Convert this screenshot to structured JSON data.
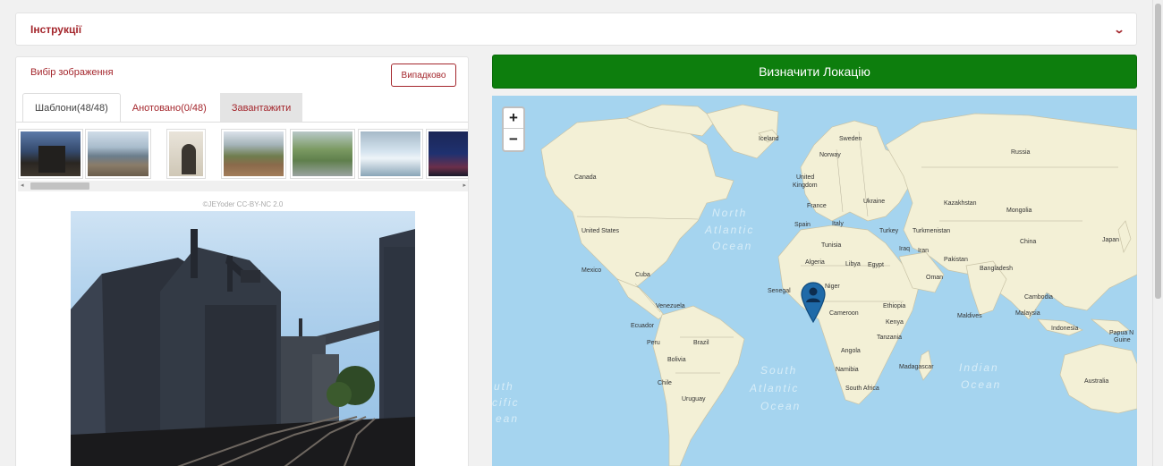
{
  "instructions": {
    "label": "Інструкції",
    "toggle_icon": "chevron-down-icon"
  },
  "image_select": {
    "title": "Вибір зображення",
    "random_button": "Випадково",
    "tabs": [
      {
        "label": "Шаблони(48/48)",
        "active": true
      },
      {
        "label": "Анотовано(0/48)",
        "active": false
      },
      {
        "label": "Завантажити",
        "active": false
      }
    ],
    "thumbnails": [
      "thumbnail",
      "thumbnail",
      "thumbnail",
      "thumbnail",
      "thumbnail",
      "thumbnail",
      "thumbnail"
    ],
    "caption": "©JEYoder CC-BY-NC 2.0"
  },
  "locate_button": "Визначити Локацію",
  "map": {
    "zoom_in": "+",
    "zoom_out": "−",
    "oceans": {
      "north_atlantic_1": "North",
      "north_atlantic_2": "Atlantic",
      "north_atlantic_3": "Ocean",
      "south_atlantic_1": "South",
      "south_atlantic_2": "Atlantic",
      "south_atlantic_3": "Ocean",
      "indian_1": "Indian",
      "indian_2": "Ocean",
      "south_pacific_1": "uth",
      "south_pacific_2": "cific",
      "south_pacific_3": "ean"
    },
    "labels": {
      "iceland": "Iceland",
      "sweden": "Sweden",
      "norway": "Norway",
      "russia": "Russia",
      "canada": "Canada",
      "united_kingdom_1": "United",
      "united_kingdom_2": "Kingdom",
      "france": "France",
      "ukraine": "Ukraine",
      "kazakhstan": "Kazakhstan",
      "mongolia": "Mongolia",
      "united_states": "United States",
      "spain": "Spain",
      "italy": "Italy",
      "turkey": "Turkey",
      "turkmenistan": "Turkmenistan",
      "china": "China",
      "japan": "Japan",
      "tunisia": "Tunisia",
      "iraq": "Iraq",
      "iran": "Iran",
      "pakistan": "Pakistan",
      "mexico": "Mexico",
      "algeria": "Algeria",
      "libya": "Libya",
      "egypt": "Egypt",
      "cuba": "Cuba",
      "bangladesh": "Bangladesh",
      "oman": "Oman",
      "senegal": "Senegal",
      "niger": "Niger",
      "venezuela": "Venezuela",
      "cambodia": "Cambodia",
      "ethiopia": "Ethiopia",
      "ecuador": "Ecuador",
      "cameroon": "Cameroon",
      "kenya": "Kenya",
      "maldives": "Maldives",
      "malaysia": "Malaysia",
      "papua_1": "Papua N",
      "papua_2": "Guine",
      "indonesia": "Indonesia",
      "peru": "Peru",
      "brazil": "Brazil",
      "tanzania": "Tanzania",
      "angola": "Angola",
      "bolivia": "Bolivia",
      "namibia": "Namibia",
      "madagascar": "Madagascar",
      "chile": "Chile",
      "south_africa": "South Africa",
      "uruguay": "Uruguay",
      "australia": "Australia"
    },
    "marker_icon": "map-pin-icon"
  },
  "colors": {
    "accent": "#a4262c",
    "locate_green": "#0d7e0d",
    "water": "#a5d4ef",
    "land": "#f3f0d6",
    "marker": "#1f6aa8"
  }
}
